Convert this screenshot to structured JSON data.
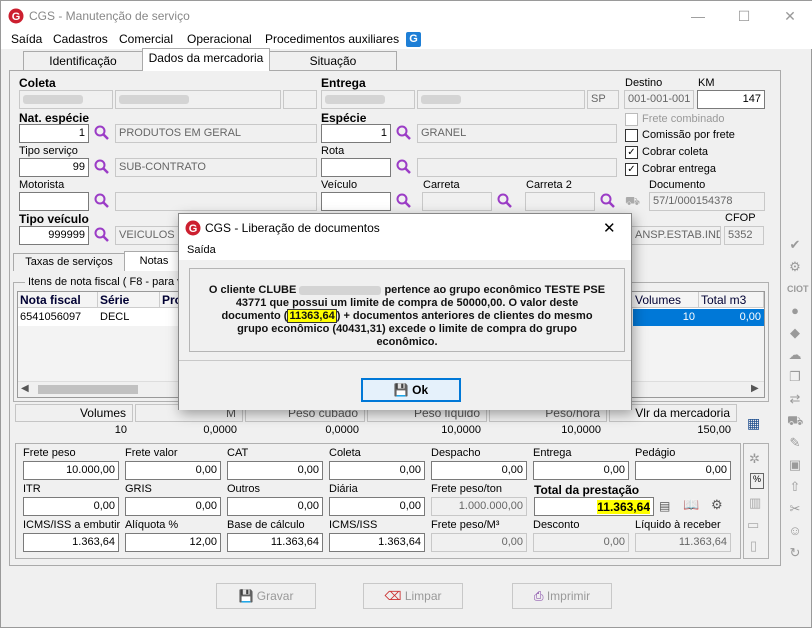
{
  "window": {
    "title": "CGS - Manutenção de serviço",
    "minimize": "—",
    "maximize": "☐",
    "close": "✕"
  },
  "menu": [
    "Saída",
    "Cadastros",
    "Comercial",
    "Operacional",
    "Procedimentos auxiliares"
  ],
  "tabs": [
    "Identificação",
    "Dados da mercadoria",
    "Situação"
  ],
  "form": {
    "coleta_label": "Coleta",
    "entrega_label": "Entrega",
    "entrega_uf": "SP",
    "destino_label": "Destino",
    "destino_value": "001-001-001",
    "km_label": "KM",
    "km_value": "147",
    "nat_especie_label": "Nat. espécie",
    "nat_especie_code": "1",
    "nat_especie_desc": "PRODUTOS EM GERAL",
    "especie_label": "Espécie",
    "especie_code": "1",
    "especie_desc": "GRANEL",
    "tipo_servico_label": "Tipo serviço",
    "tipo_servico_code": "99",
    "tipo_servico_desc": "SUB-CONTRATO",
    "rota_label": "Rota",
    "motorista_label": "Motorista",
    "veiculo_label": "Veículo",
    "carreta_label": "Carreta",
    "carreta2_label": "Carreta 2",
    "documento_label": "Documento",
    "documento_value": "57/1/000154378",
    "tipo_veiculo_label": "Tipo veículo",
    "tipo_veiculo_code": "999999",
    "tipo_veiculo_desc": "VEICULOS D",
    "operacao_partial": "ANSP.ESTAB.IND",
    "cfop_label": "CFOP",
    "cfop_value": "5352",
    "frete_combinado": "Frete combinado",
    "comissao_frete": "Comissão por frete",
    "cobrar_coleta": "Cobrar coleta",
    "cobrar_entrega": "Cobrar entrega"
  },
  "subtabs": [
    "Taxas de serviços",
    "Notas"
  ],
  "nf_group_title": "Itens de nota fiscal ( F8 - para vi",
  "table": {
    "headers": [
      "Nota fiscal",
      "Série",
      "Pro",
      "Volumes",
      "Total m3"
    ],
    "row": {
      "nota": "6541056097",
      "serie": "DECL",
      "volumes": "10",
      "total_m3": "0,00"
    }
  },
  "summary": {
    "headers": [
      "Volumes",
      "M",
      "Peso cubado",
      "Peso líquido",
      "Peso/hora",
      "Vlr da mercadoria"
    ],
    "values": [
      "10",
      "0,0000",
      "0,0000",
      "10,0000",
      "10,0000",
      "150,00"
    ]
  },
  "costs": {
    "row1": [
      {
        "l": "Frete peso",
        "v": "10.000,00"
      },
      {
        "l": "Frete valor",
        "v": "0,00"
      },
      {
        "l": "CAT",
        "v": "0,00"
      },
      {
        "l": "Coleta",
        "v": "0,00"
      },
      {
        "l": "Despacho",
        "v": "0,00"
      },
      {
        "l": "Entrega",
        "v": "0,00"
      },
      {
        "l": "Pedágio",
        "v": "0,00"
      }
    ],
    "row2": [
      {
        "l": "ITR",
        "v": "0,00"
      },
      {
        "l": "GRIS",
        "v": "0,00"
      },
      {
        "l": "Outros",
        "v": "0,00"
      },
      {
        "l": "Diária",
        "v": "0,00"
      },
      {
        "l": "Frete peso/ton",
        "v": "1.000.000,00"
      }
    ],
    "total_prestacao_label": "Total da prestação",
    "total_prestacao_value": "11.363,64",
    "row3": [
      {
        "l": "ICMS/ISS a embutir",
        "v": "1.363,64"
      },
      {
        "l": "Alíquota %",
        "v": "12,00"
      },
      {
        "l": "Base de cálculo",
        "v": "11.363,64"
      },
      {
        "l": "ICMS/ISS",
        "v": "1.363,64"
      },
      {
        "l": "Frete peso/M³",
        "v": "0,00"
      },
      {
        "l": "Desconto",
        "v": "0,00"
      },
      {
        "l": "Líquido à receber",
        "v": "11.363,64"
      }
    ]
  },
  "buttons": {
    "gravar": "Gravar",
    "limpar": "Limpar",
    "imprimir": "Imprimir"
  },
  "dialog": {
    "title": "CGS - Liberação de documentos",
    "menu": "Saída",
    "msg_pre": "O cliente CLUBE",
    "msg_post": "pertence ao grupo econômico TESTE PSE 43771 que possui um limite de compra de 50000,00. O valor deste documento (",
    "msg_value": "11363,64",
    "msg_end": ") + documentos anteriores de clientes do mesmo grupo econômico (40431,31) excede o limite de compra do grupo econômico.",
    "ok": "Ok",
    "close": "✕"
  },
  "colors": {
    "accent": "#0078d7",
    "highlight": "#ffff00",
    "logo": "#cc1f2f"
  }
}
